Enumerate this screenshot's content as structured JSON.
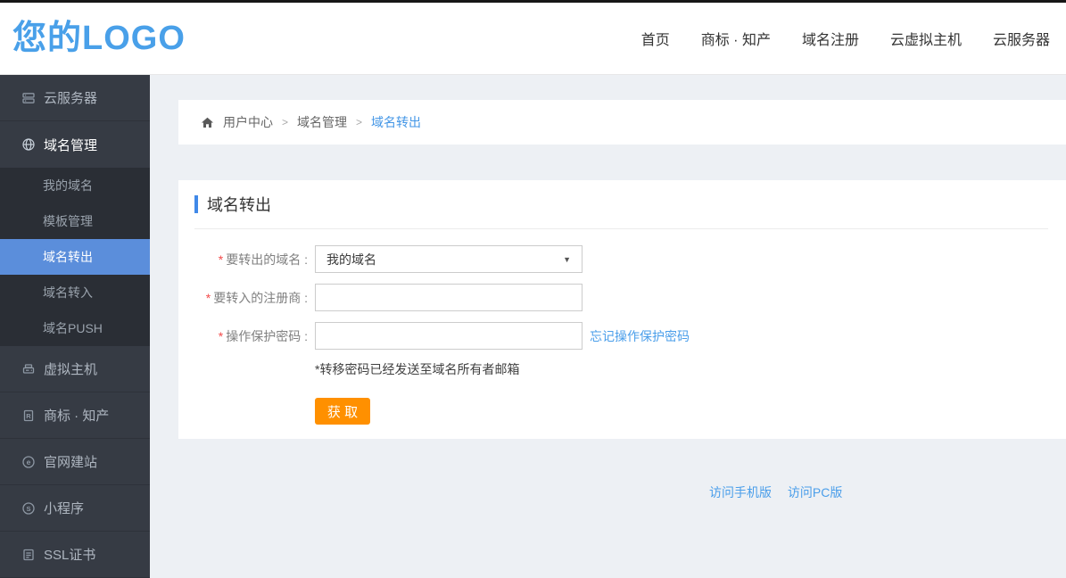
{
  "header": {
    "logo": "您的LOGO",
    "nav": [
      "首页",
      "商标 · 知产",
      "域名注册",
      "云虚拟主机",
      "云服务器"
    ]
  },
  "sidebar": {
    "items": [
      {
        "label": "云服务器",
        "icon": "cloud-server-icon"
      },
      {
        "label": "域名管理",
        "icon": "globe-icon",
        "state": "open"
      },
      {
        "label": "虚拟主机",
        "icon": "host-icon"
      },
      {
        "label": "商标 · 知产",
        "icon": "trademark-icon"
      },
      {
        "label": "官网建站",
        "icon": "website-icon"
      },
      {
        "label": "小程序",
        "icon": "miniprogram-icon"
      },
      {
        "label": "SSL证书",
        "icon": "ssl-cert-icon"
      }
    ],
    "submenu": [
      {
        "label": "我的域名"
      },
      {
        "label": "模板管理"
      },
      {
        "label": "域名转出",
        "active": true
      },
      {
        "label": "域名转入"
      },
      {
        "label": "域名PUSH"
      }
    ]
  },
  "breadcrumb": {
    "home": "用户中心",
    "sep": ">",
    "level2": "域名管理",
    "current": "域名转出"
  },
  "main": {
    "title": "域名转出",
    "form": {
      "required_mark": "*",
      "rows": [
        {
          "label": "要转出的域名 :",
          "type": "select",
          "value": "我的域名"
        },
        {
          "label": "要转入的注册商 :",
          "type": "input",
          "value": ""
        },
        {
          "label": "操作保护密码 :",
          "type": "input",
          "value": "",
          "link": "忘记操作保护密码"
        }
      ],
      "note": "*转移密码已经发送至域名所有者邮箱",
      "submit_label": "获 取"
    }
  },
  "footer": {
    "links": [
      "访问手机版",
      "访问PC版"
    ]
  },
  "colors": {
    "logo_blue": "#49a0e9",
    "link_blue": "#4a9eea",
    "active_menu_blue": "#5b8edb",
    "title_bar_blue": "#4089e8",
    "button_orange": "#ff9000",
    "sidebar_bg": "#363b44",
    "submenu_bg": "#2a2e35",
    "page_bg": "#edf0f4"
  }
}
